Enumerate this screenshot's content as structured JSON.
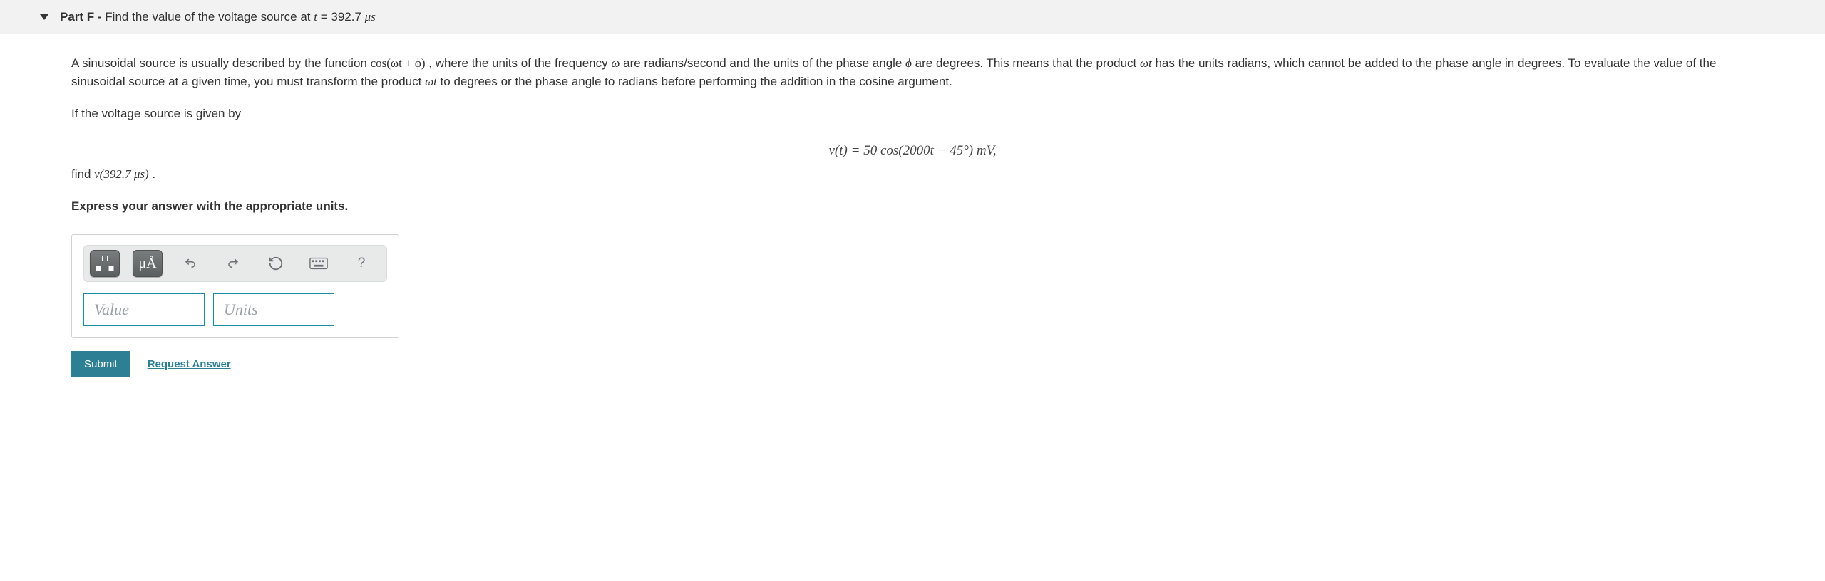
{
  "part": {
    "label": "Part F - ",
    "title_prefix": "Find the value of the voltage source at ",
    "title_var": "t",
    "title_eq": " = 392.7 ",
    "title_unit": "μs"
  },
  "body": {
    "intro_1": "A sinusoidal source is usually described by the function ",
    "intro_fn": "cos(ωt + ϕ)",
    "intro_2": ", where the units of the frequency ",
    "omega": "ω",
    "intro_3": " are radians/second and the units of the phase angle ",
    "phi": "ϕ",
    "intro_4": " are degrees. This means that the product ",
    "wt1": "ωt",
    "intro_5": " has the units radians, which cannot be added to the phase angle in degrees. To evaluate the value of the sinusoidal source at a given time, you must transform the product ",
    "wt2": "ωt",
    "intro_6": " to degrees or the phase angle to radians before performing the addition in the cosine argument.",
    "given_by": "If the voltage source is given by",
    "equation": "v(t) = 50 cos(2000t − 45°) mV,",
    "find_1": "find ",
    "find_fn": "v(392.7 μs)",
    "find_2": ".",
    "express": "Express your answer with the appropriate units."
  },
  "toolbar": {
    "templates_tip": "templates",
    "units_symbol": "μÅ",
    "undo_tip": "undo",
    "redo_tip": "redo",
    "reset_tip": "reset",
    "keyboard_tip": "keyboard shortcuts",
    "help_tip": "?"
  },
  "inputs": {
    "value_placeholder": "Value",
    "units_placeholder": "Units"
  },
  "actions": {
    "submit": "Submit",
    "request": "Request Answer"
  }
}
